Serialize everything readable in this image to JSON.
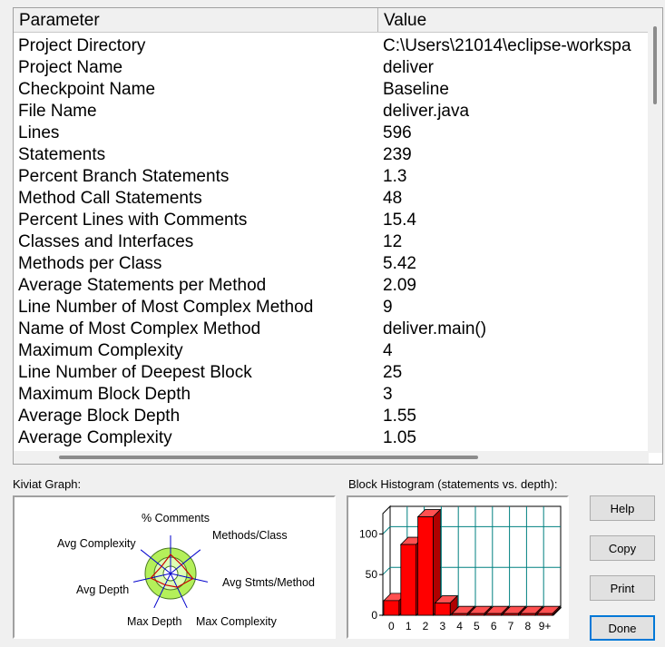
{
  "table": {
    "headers": {
      "parameter": "Parameter",
      "value": "Value"
    },
    "rows": [
      {
        "parameter": "Project Directory",
        "value": "C:\\Users\\21014\\eclipse-workspa"
      },
      {
        "parameter": "Project Name",
        "value": "deliver"
      },
      {
        "parameter": "Checkpoint Name",
        "value": "Baseline"
      },
      {
        "parameter": "File Name",
        "value": "deliver.java"
      },
      {
        "parameter": "Lines",
        "value": "596"
      },
      {
        "parameter": "Statements",
        "value": "239"
      },
      {
        "parameter": "Percent Branch Statements",
        "value": "1.3"
      },
      {
        "parameter": "Method Call Statements",
        "value": "48"
      },
      {
        "parameter": "Percent Lines with Comments",
        "value": "15.4"
      },
      {
        "parameter": "Classes and Interfaces",
        "value": "12"
      },
      {
        "parameter": "Methods per Class",
        "value": "5.42"
      },
      {
        "parameter": "Average Statements per Method",
        "value": "2.09"
      },
      {
        "parameter": "Line Number of Most Complex Method",
        "value": "9"
      },
      {
        "parameter": "Name of Most Complex Method",
        "value": "deliver.main()"
      },
      {
        "parameter": "Maximum Complexity",
        "value": "4"
      },
      {
        "parameter": "Line Number of Deepest Block",
        "value": "25"
      },
      {
        "parameter": "Maximum Block Depth",
        "value": "3"
      },
      {
        "parameter": "Average Block Depth",
        "value": "1.55"
      },
      {
        "parameter": "Average Complexity",
        "value": "1.05"
      }
    ]
  },
  "kiviat": {
    "label": "Kiviat Graph:",
    "axes": [
      "% Comments",
      "Methods/Class",
      "Avg Stmts/Method",
      "Max Complexity",
      "Max Depth",
      "Avg Depth",
      "Avg Complexity"
    ],
    "colors": {
      "outer_ring": "#b4f05a",
      "inner_ring": "#dcffb4",
      "plot_line": "#cc0000",
      "spoke": "#0000cc"
    }
  },
  "histogram": {
    "label": "Block Histogram (statements vs. depth):",
    "colors": {
      "bar": "#ff0000",
      "grid": "#008080"
    }
  },
  "chart_data": {
    "type": "bar",
    "title": "Block Histogram (statements vs. depth):",
    "categories": [
      "0",
      "1",
      "2",
      "3",
      "4",
      "5",
      "6",
      "7",
      "8",
      "9+"
    ],
    "values": [
      18,
      87,
      121,
      15,
      2,
      2,
      2,
      2,
      2,
      2
    ],
    "yticks": [
      "0",
      "50",
      "100"
    ],
    "ylim": [
      0,
      125
    ],
    "grid": true,
    "style": "3d"
  },
  "buttons": {
    "help": "Help",
    "copy": "Copy",
    "print": "Print",
    "done": "Done"
  }
}
